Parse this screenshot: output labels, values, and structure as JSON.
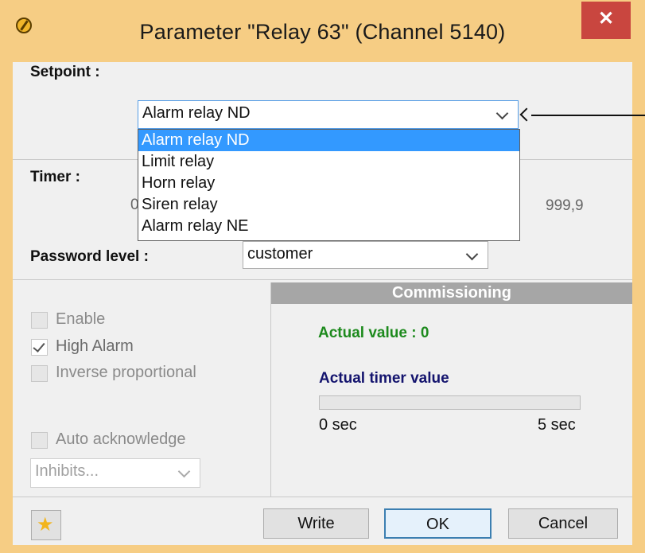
{
  "window": {
    "title": "Parameter \"Relay 63\" (Channel 5140)",
    "close_glyph": "✕",
    "app_icon": "relay-app-icon"
  },
  "setpoint": {
    "label": "Setpoint :",
    "selected": "Alarm relay ND",
    "options": [
      "Alarm relay ND",
      "Limit relay",
      "Horn  relay",
      "Siren relay",
      "Alarm relay NE"
    ],
    "selected_index": 0
  },
  "timer": {
    "label": "Timer :",
    "min_partial": "0",
    "max": "999,9"
  },
  "password": {
    "label": "Password level :",
    "value": "customer"
  },
  "options": {
    "enable": {
      "label": "Enable",
      "checked": false
    },
    "high_alarm": {
      "label": "High Alarm",
      "checked": true
    },
    "inverse": {
      "label": "Inverse proportional",
      "checked": false
    },
    "auto_ack": {
      "label": "Auto acknowledge",
      "checked": false
    },
    "inhibits": {
      "value": "Inhibits..."
    }
  },
  "commissioning": {
    "header": "Commissioning",
    "actual_value": "Actual value : 0",
    "timer_label": "Actual timer value",
    "timer_progress": 0,
    "min_label": "0 sec",
    "max_label": "5 sec"
  },
  "buttons": {
    "favorite_icon": "star-icon",
    "write": "Write",
    "ok": "OK",
    "cancel": "Cancel"
  },
  "colors": {
    "frame": "#f6cd84",
    "close": "#c9463f",
    "selection": "#3399ff",
    "actual_value": "#1d8a1d",
    "timer_label": "#14146e",
    "panel_header": "#a6a6a6"
  }
}
